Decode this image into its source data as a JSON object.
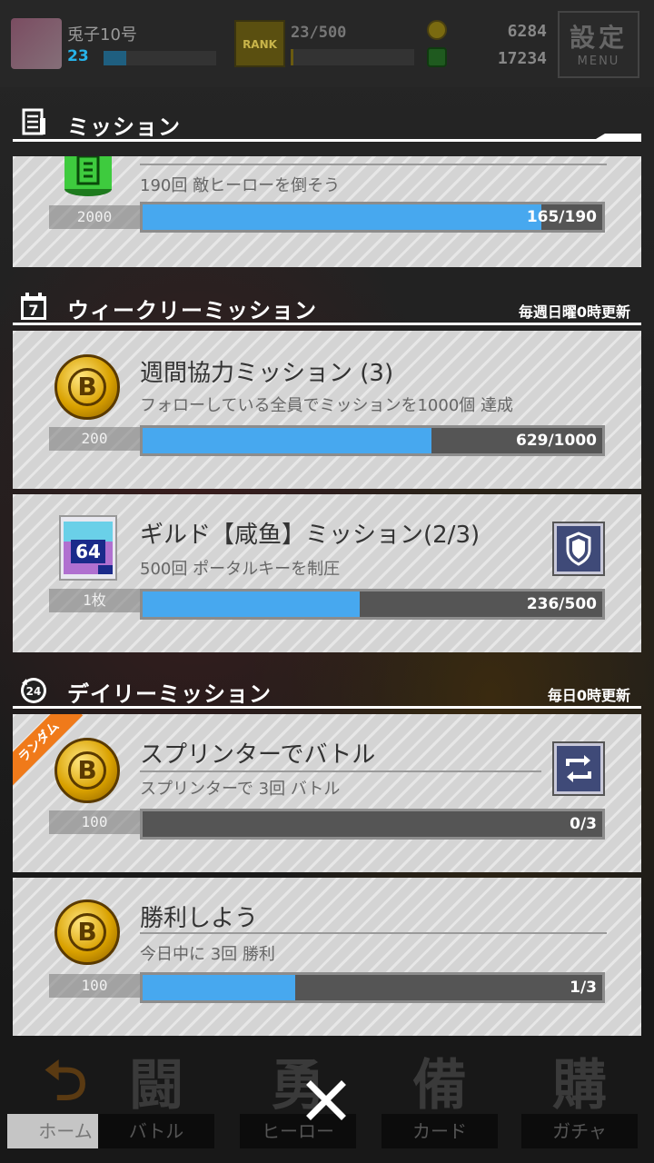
{
  "player": {
    "name": "兎子10号",
    "level": "23",
    "xp_progress": 0.2
  },
  "rank": {
    "badge": "RANK",
    "value": "23/500",
    "progress": 0.02
  },
  "currency": {
    "coins": "6284",
    "gems": "17234"
  },
  "menu": {
    "kanji": "設定",
    "label": "MENU"
  },
  "sections": {
    "missions": {
      "title": "ミッション"
    },
    "weekly": {
      "title": "ウィークリーミッション",
      "note": "毎週日曜0時更新"
    },
    "daily": {
      "title": "デイリーミッション",
      "note": "毎日0時更新",
      "icon_text": "24"
    }
  },
  "missions": [
    {
      "title": "",
      "desc": "190回 敵ヒーローを倒そう",
      "reward": "2000",
      "progress_text": "165/190",
      "progress": 0.868
    },
    {
      "title": "週間協力ミッション (3)",
      "desc": "フォローしている全員でミッションを1000個 達成",
      "reward": "200",
      "progress_text": "629/1000",
      "progress": 0.629,
      "coin_letter": "B"
    },
    {
      "title": "ギルド【咸鱼】ミッション(2/3)",
      "desc": "500回 ポータルキーを制圧",
      "reward": "1枚",
      "progress_text": "236/500",
      "progress": 0.472,
      "card_number": "64"
    },
    {
      "title": "スプリンターでバトル",
      "desc": "スプリンターで 3回 バトル",
      "reward": "100",
      "progress_text": "0/3",
      "progress": 0.0,
      "ribbon": "ランダム",
      "coin_letter": "B"
    },
    {
      "title": "勝利しよう",
      "desc": "今日中に 3回 勝利",
      "reward": "100",
      "progress_text": "1/3",
      "progress": 0.333,
      "coin_letter": "B"
    }
  ],
  "nav": [
    {
      "big": "⮌",
      "label": "ホーム"
    },
    {
      "big": "闘",
      "label": "バトル"
    },
    {
      "big": "勇",
      "label": "ヒーロー"
    },
    {
      "big": "備",
      "label": "カード"
    },
    {
      "big": "購",
      "label": "ガチャ"
    }
  ],
  "colors": {
    "progress_fill": "#47a8ef",
    "ribbon": "#f07a1a",
    "coin": "#d9a100"
  }
}
